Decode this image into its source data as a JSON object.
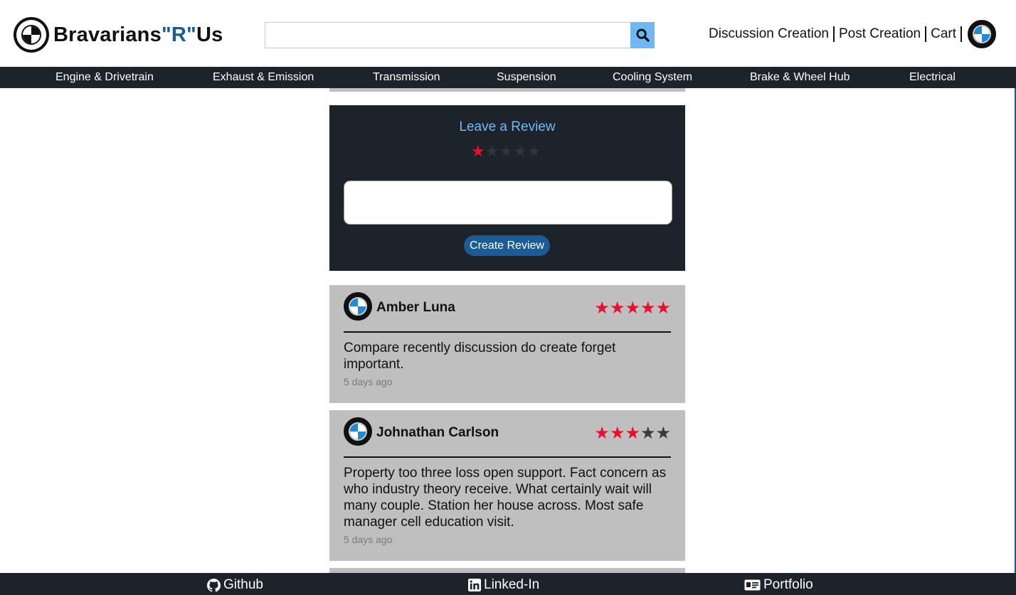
{
  "header": {
    "brand_main": "Bravarians",
    "brand_r": "\"R\"",
    "brand_us": "Us",
    "search_placeholder": "",
    "nav": [
      "Discussion Creation",
      "Post Creation",
      "Cart"
    ]
  },
  "categories": [
    "Engine & Drivetrain",
    "Exhaust & Emission",
    "Transmission",
    "Suspension",
    "Cooling System",
    "Brake & Wheel Hub",
    "Electrical"
  ],
  "review_form": {
    "title": "Leave a Review",
    "rating": 1,
    "max_rating": 5,
    "textarea_value": "",
    "submit_label": "Create Review"
  },
  "reviews": [
    {
      "name": "Amber Luna",
      "rating": 5,
      "body": "Compare recently discussion do create forget important.",
      "time": "5 days ago"
    },
    {
      "name": "Johnathan Carlson",
      "rating": 3,
      "body": "Property too three loss open support. Fact concern as who industry theory receive. What certainly wait will many couple. Station her house across. Most safe manager cell education visit.",
      "time": "5 days ago"
    }
  ],
  "footer": {
    "github": "Github",
    "linkedin": "Linked-In",
    "portfolio": "Portfolio"
  },
  "colors": {
    "accent_blue": "#1b5c94",
    "light_blue": "#74b9f5",
    "star_red": "#e8112d",
    "dark_bar": "#1d232b",
    "card_gray": "#bfbfbf"
  },
  "icons": [
    "bmw-logo-icon",
    "search-icon",
    "github-icon",
    "linkedin-icon",
    "portfolio-icon",
    "star-icon"
  ]
}
